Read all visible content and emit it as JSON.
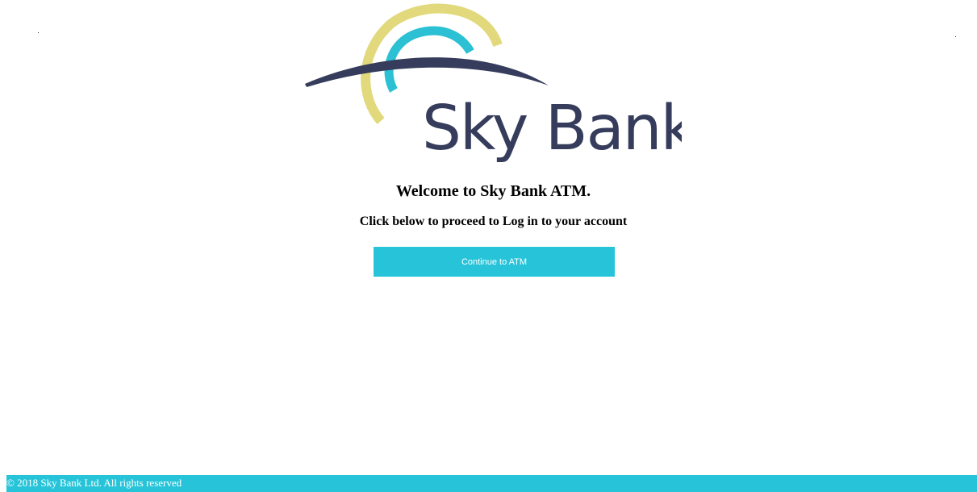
{
  "brand": {
    "name": "Sky Bank",
    "colors": {
      "navy": "#363d5c",
      "yellow": "#e1d97c",
      "cyan": "#2bc0d3"
    }
  },
  "main": {
    "welcome": "Welcome to Sky Bank ATM.",
    "subtitle": "Click below to proceed to Log in to your account",
    "continue_label": "Continue to ATM"
  },
  "footer": {
    "text": "© 2018 Sky Bank Ltd. All rights reserved"
  },
  "colors": {
    "accent": "#27c4d9",
    "background": "#ffffff",
    "text": "#000000"
  }
}
